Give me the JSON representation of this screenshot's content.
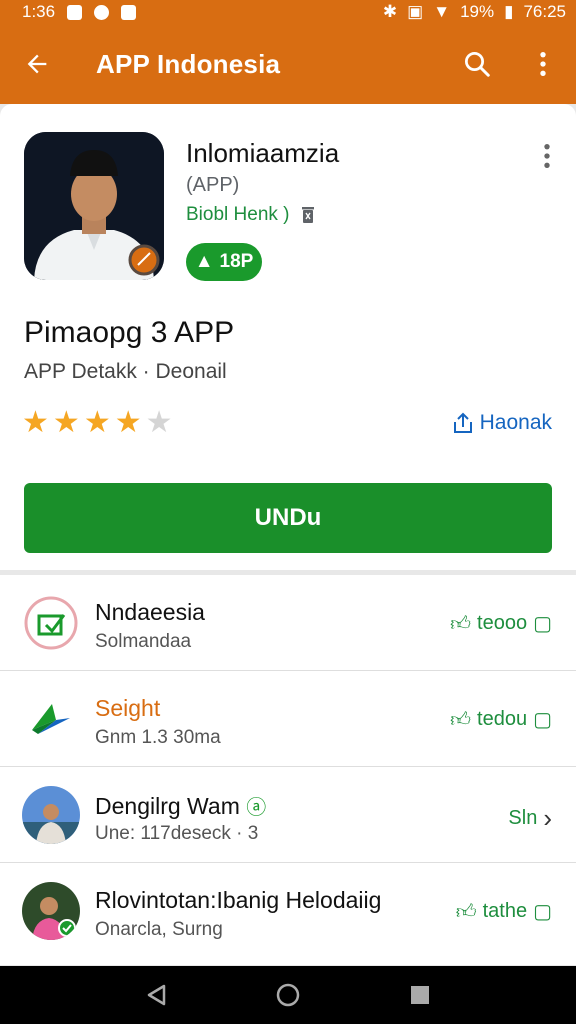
{
  "status_bar": {
    "time_left": "1:36",
    "battery": "19%",
    "time_right": "76:25"
  },
  "app_bar": {
    "title": "APP Indonesia"
  },
  "app": {
    "name": "Inlomiaamzia",
    "type": "(APP)",
    "developer": "Biobl Henk )",
    "badge": "18P",
    "headline": "Pimaopg 3 APP",
    "subline": "APP Detakk · Deonail",
    "rating_stars": 4,
    "rating_max": 5,
    "share_label": "Haonak",
    "install_label": "UNDu"
  },
  "list": [
    {
      "title": "Nndaeesia",
      "subtitle": "Solmandaa",
      "action": "teooo",
      "title_color": "#111111"
    },
    {
      "title": "Seight",
      "subtitle": "Gnm 1.3 30ma",
      "action": "tedou",
      "title_color": "#d86d12"
    },
    {
      "title": "Dengilrg Wam",
      "subtitle": "Une: 117deseck · 3",
      "action": "Sln"
    },
    {
      "title": "Rlovintotan:Ibanig Helodaiig",
      "subtitle": "Onarcla, Surng",
      "action": "tathe"
    }
  ],
  "colors": {
    "primary": "#d86d12",
    "accent_green": "#1a8f2a",
    "link_blue": "#1565c0",
    "star": "#f5a623"
  }
}
